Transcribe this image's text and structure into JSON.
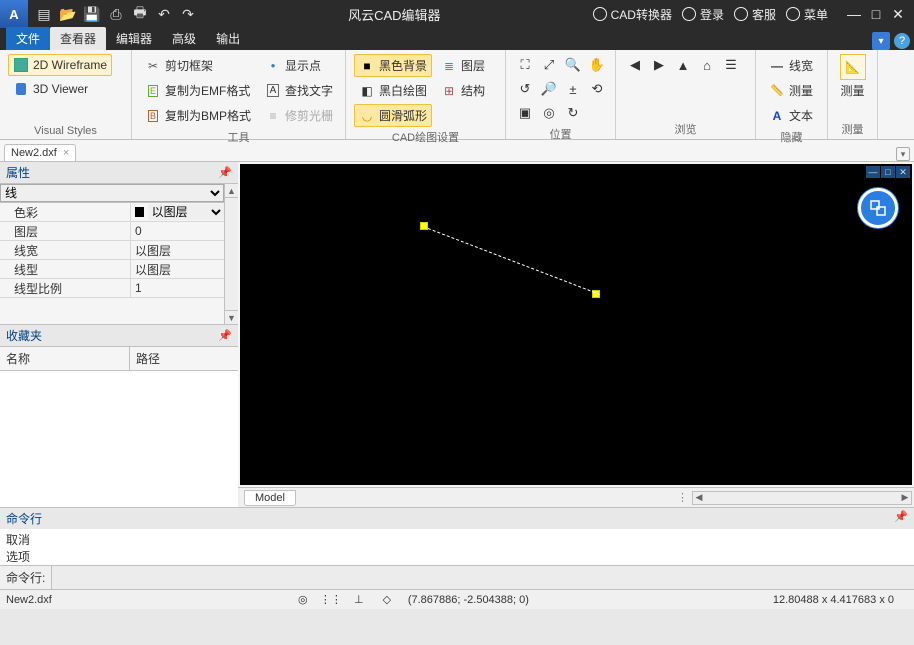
{
  "app": {
    "title": "风云CAD编辑器"
  },
  "qat": [
    "new",
    "open",
    "save",
    "saveall",
    "print",
    "undo",
    "redo"
  ],
  "titleright": {
    "conv": "CAD转换器",
    "login": "登录",
    "service": "客服",
    "menu": "菜单"
  },
  "tabs": {
    "file": "文件",
    "viewer": "查看器",
    "editor": "编辑器",
    "advanced": "高级",
    "output": "输出"
  },
  "ribbon": {
    "visual": {
      "label": "Visual Styles",
      "wire": "2D Wireframe",
      "viewer3d": "3D Viewer"
    },
    "tools": {
      "label": "工具",
      "crop": "剪切框架",
      "emf": "复制为EMF格式",
      "bmp": "复制为BMP格式",
      "showpt": "显示点",
      "findtxt": "查找文字",
      "trim": "修剪光栅"
    },
    "cadset": {
      "label": "CAD绘图设置",
      "blackbg": "黑色背景",
      "bwdraw": "黑白绘图",
      "smootharc": "圆滑弧形",
      "layer": "图层",
      "struct": "结构"
    },
    "pos": {
      "label": "位置"
    },
    "browse": {
      "label": "浏览"
    },
    "hide": {
      "label": "隐藏",
      "linew": "线宽",
      "measure": "测量",
      "text": "文本"
    },
    "measure": {
      "label": "测量"
    }
  },
  "doc": {
    "filename": "New2.dxf"
  },
  "props": {
    "title": "属性",
    "type": "线",
    "rows": [
      {
        "k": "色彩",
        "v": "以图层",
        "swatch": true,
        "combo": true
      },
      {
        "k": "图层",
        "v": "0"
      },
      {
        "k": "线宽",
        "v": "以图层"
      },
      {
        "k": "线型",
        "v": "以图层"
      },
      {
        "k": "线型比例",
        "v": "1"
      }
    ]
  },
  "fav": {
    "title": "收藏夹",
    "col1": "名称",
    "col2": "路径"
  },
  "modeltab": "Model",
  "cmd": {
    "title": "命令行",
    "log1": "取消",
    "log2": "选项",
    "prompt": "命令行:"
  },
  "status": {
    "file": "New2.dxf",
    "coords": "(7.867886; -2.504388; 0)",
    "dims": "12.80488 x 4.417683 x 0"
  }
}
